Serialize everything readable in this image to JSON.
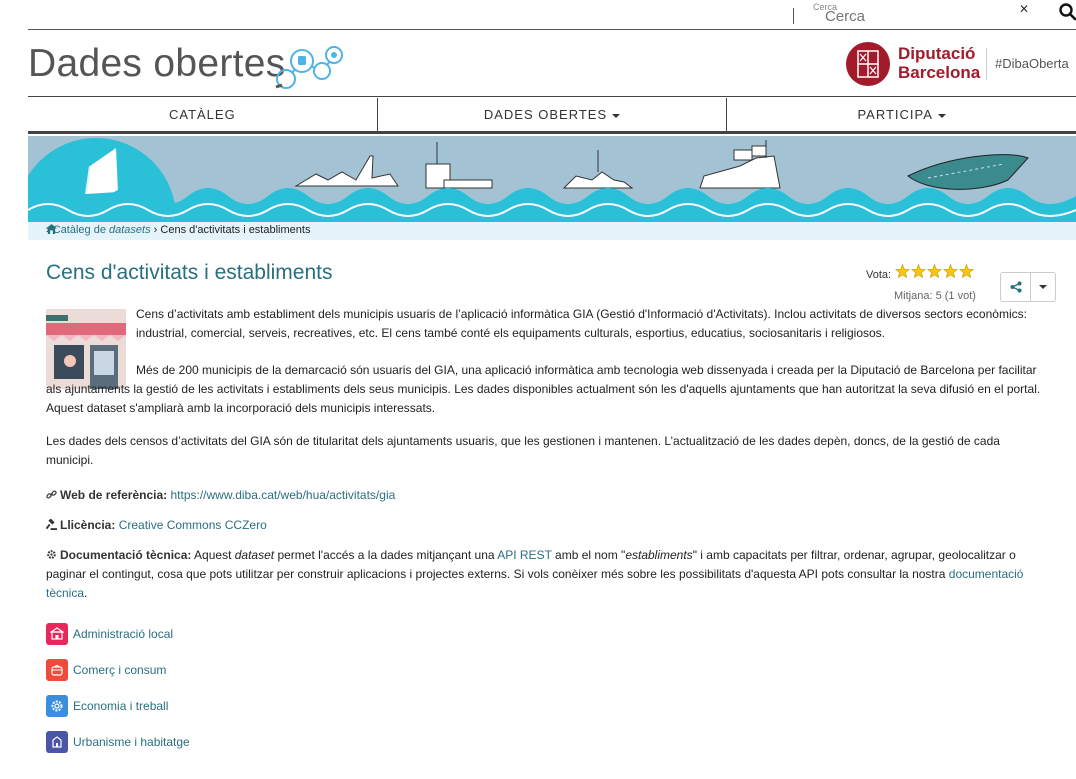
{
  "search": {
    "small_label": "Cerca",
    "placeholder": "Cerca"
  },
  "header": {
    "site_title": "Dades obertes",
    "brand_line1": "Diputació",
    "brand_line2": "Barcelona",
    "hashtag": "#DibaOberta"
  },
  "nav": {
    "items": [
      {
        "label": "CATÀLEG"
      },
      {
        "label": "DADES OBERTES"
      },
      {
        "label": "PARTICIPA"
      }
    ]
  },
  "breadcrumb": {
    "catalog_prefix": "Catàleg de ",
    "catalog_em": "datasets",
    "current": "Cens d'activitats i establiments",
    "sep": "›"
  },
  "dataset": {
    "title": "Cens d'activitats i establiments",
    "vote_label": "Vota:",
    "rating": 5,
    "average": "Mitjana: 5 (1 vot)",
    "description_1": "Cens d’activitats amb establiment dels municipis usuaris de l’aplicació informàtica GIA (Gestió d'Informació d'Activitats). Inclou activitats de diversos sectors econòmics: industrial, comercial, serveis, recreatives, etc. El cens també conté els equipaments culturals, esportius, educatius, sociosanitaris i religiosos.",
    "description_2": "Més de 200 municipis de la demarcació són usuaris del GIA, una aplicació informàtica amb tecnologia web dissenyada i creada per la Diputació de Barcelona per facilitar als ajuntaments la gestió de les activitats i establiments dels seus municipis. Les dades disponibles actualment són les d'aquells ajuntaments que han autoritzat la seva difusió en el portal. Aquest dataset s'ampliarà amb la incorporació dels municipis interessats.",
    "description_3": "Les dades dels censos d’activitats del GIA són de titularitat dels ajuntaments usuaris, que les gestionen i mantenen. L’actualització de les dades depèn, doncs, de la gestió de cada municipi.",
    "web_label": "Web de referència:",
    "web_url": "https://www.diba.cat/web/hua/activitats/gia",
    "license_label": "Llicència:",
    "license_value": "Creative Commons CCZero",
    "docs_label": "Documentació tècnica:",
    "docs_text_1": " Aquest ",
    "docs_em_1": "dataset",
    "docs_text_2": " permet l'accés a la dades mitjançant una ",
    "docs_link_api": "API REST",
    "docs_text_3": " amb el nom \"",
    "docs_em_2": "establiments",
    "docs_text_4": "\" i amb capacitats per filtrar, ordenar, agrupar, geolocalitzar o paginar el contingut, cosa que pots utilitzar per construir aplicacions i projectes externs. Si vols conèixer més sobre les possibilitats d'aquesta API pots consultar la nostra ",
    "docs_link_doc": "documentació tècnica",
    "docs_text_5": "."
  },
  "categories": [
    {
      "label": "Administració local",
      "color": "#e8285a",
      "icon": "building-icon"
    },
    {
      "label": "Comerç i consum",
      "color": "#ef4a3c",
      "icon": "shopping-bag-icon"
    },
    {
      "label": "Economia i treball",
      "color": "#3a8fdc",
      "icon": "gear-icon"
    },
    {
      "label": "Urbanisme i habitatge",
      "color": "#4a56a6",
      "icon": "house-icon"
    }
  ],
  "colors": {
    "accent": "#2a6f80",
    "brand": "#a31a2b",
    "banner_sky": "#a3c2d3",
    "wave": "#29c0d8",
    "star": "#f5c518"
  }
}
